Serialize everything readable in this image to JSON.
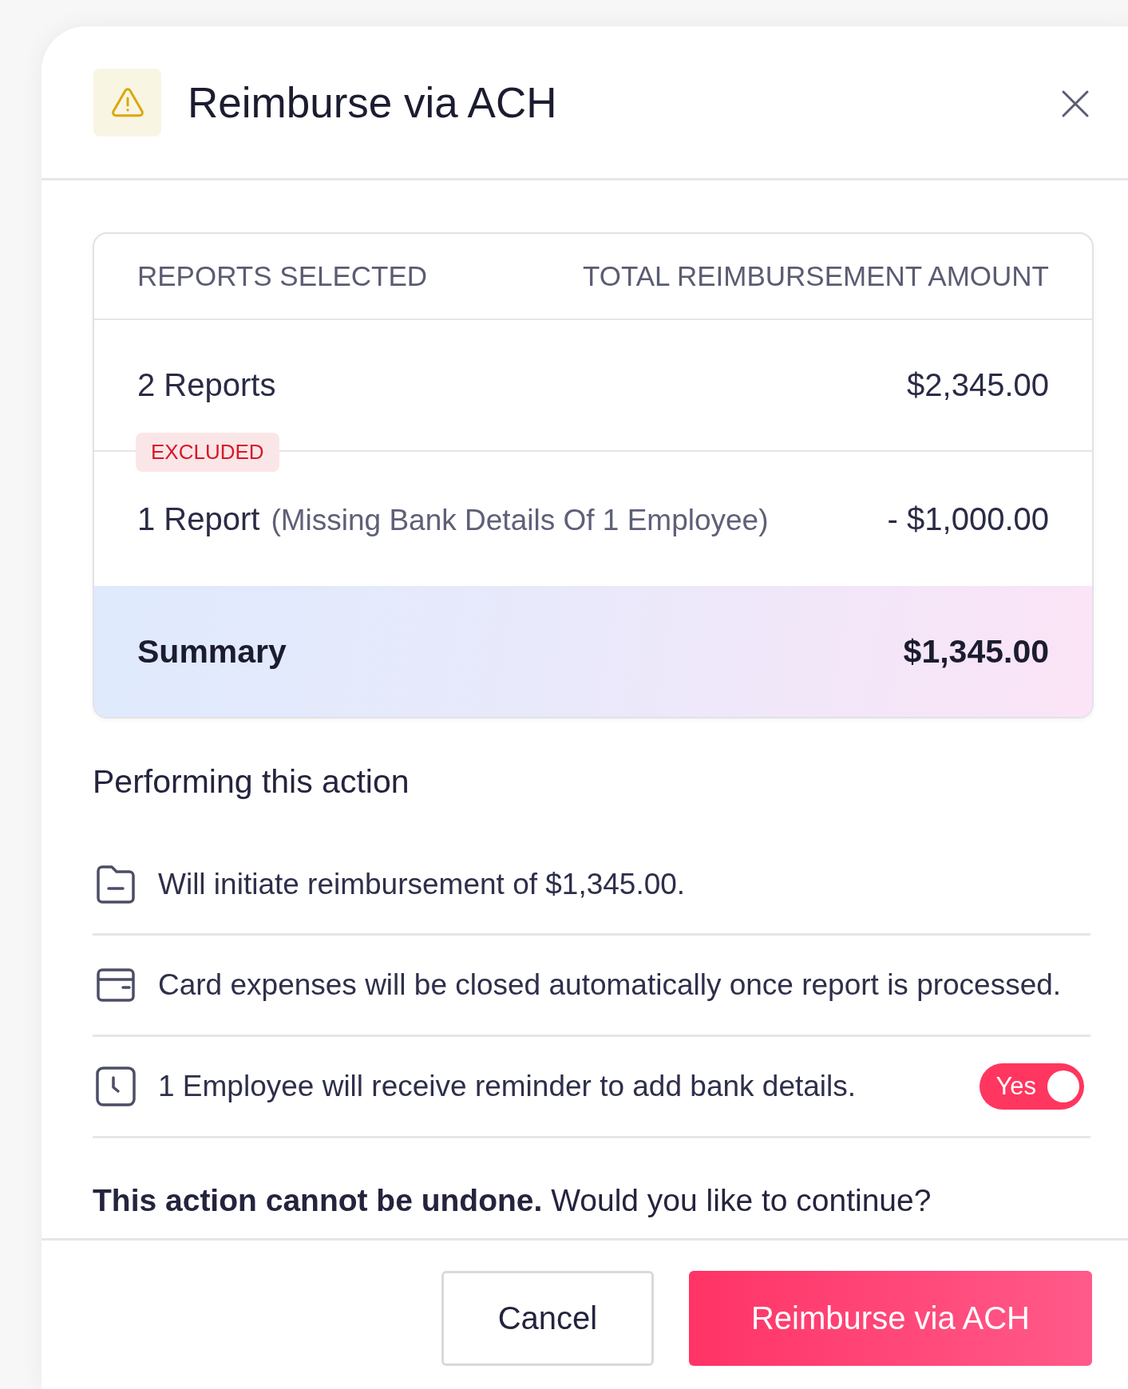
{
  "dialog": {
    "title": "Reimburse via ACH"
  },
  "summary_table": {
    "columns": [
      "REPORTS SELECTED",
      "TOTAL REIMBURSEMENT AMOUNT"
    ],
    "rows": [
      {
        "kind": "included",
        "label": "2 Reports",
        "amount": "$2,345.00"
      },
      {
        "kind": "excluded",
        "badge": "EXCLUDED",
        "label": "1 Report",
        "note": "(Missing Bank Details Of 1 Employee)",
        "amount": "- $1,000.00"
      }
    ],
    "summary": {
      "label": "Summary",
      "amount": "$1,345.00"
    }
  },
  "actions": {
    "heading": "Performing this action",
    "items": [
      {
        "kind": "folder",
        "text": "Will initiate reimbursement of $1,345.00."
      },
      {
        "kind": "card",
        "text": "Card expenses will be closed automatically once report is processed."
      },
      {
        "kind": "clock",
        "text": "1 Employee will receive reminder to add bank details.",
        "toggle": {
          "label": "Yes",
          "on": true
        }
      }
    ]
  },
  "confirmation": "**This action cannot be undone.** Would you like to continue?",
  "buttons": [
    {
      "kind": "secondary",
      "label": "Cancel"
    },
    {
      "kind": "primary",
      "label": "Reimburse via ACH"
    }
  ]
}
